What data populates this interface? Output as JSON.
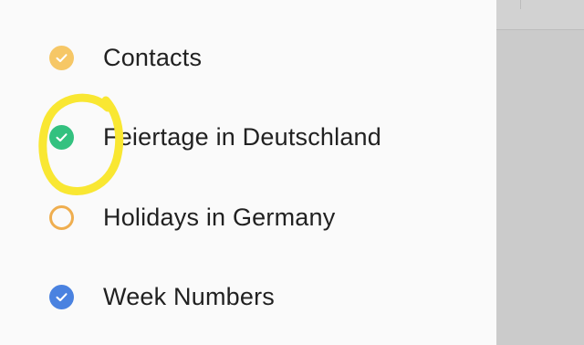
{
  "calendars": [
    {
      "label": "Contacts",
      "checked": true,
      "color": "#f6c766",
      "icon": "checkmark-icon"
    },
    {
      "label": "Feiertage in Deutschland",
      "checked": true,
      "color": "#33c17f",
      "icon": "checkmark-icon"
    },
    {
      "label": "Holidays in Germany",
      "checked": false,
      "color": "#efae4f",
      "icon": "empty-circle-icon"
    },
    {
      "label": "Week Numbers",
      "checked": true,
      "color": "#4a82e0",
      "icon": "checkmark-icon"
    }
  ],
  "annotation_color": "#f9e732",
  "scrim_color": "#cbcbcb"
}
